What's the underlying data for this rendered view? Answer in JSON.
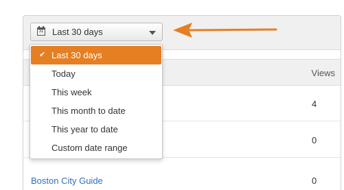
{
  "date_picker": {
    "selected_label": "Last 30 days",
    "calendar_icon_text": "31",
    "options": [
      {
        "label": "Last 30 days",
        "selected": true
      },
      {
        "label": "Today",
        "selected": false
      },
      {
        "label": "This week",
        "selected": false
      },
      {
        "label": "This month to date",
        "selected": false
      },
      {
        "label": "This year to date",
        "selected": false
      },
      {
        "label": "Custom date range",
        "selected": false
      }
    ]
  },
  "table": {
    "columns": {
      "views": "Views"
    },
    "rows": [
      {
        "name": "",
        "views": "4"
      },
      {
        "name": "",
        "views": "0"
      },
      {
        "name": "Boston City Guide",
        "views": "0"
      }
    ]
  },
  "colors": {
    "accent": "#e67e22",
    "link": "#2f6fbf"
  },
  "icons": [
    "calendar-icon",
    "chevron-down-icon",
    "check-icon",
    "arrow-icon"
  ]
}
